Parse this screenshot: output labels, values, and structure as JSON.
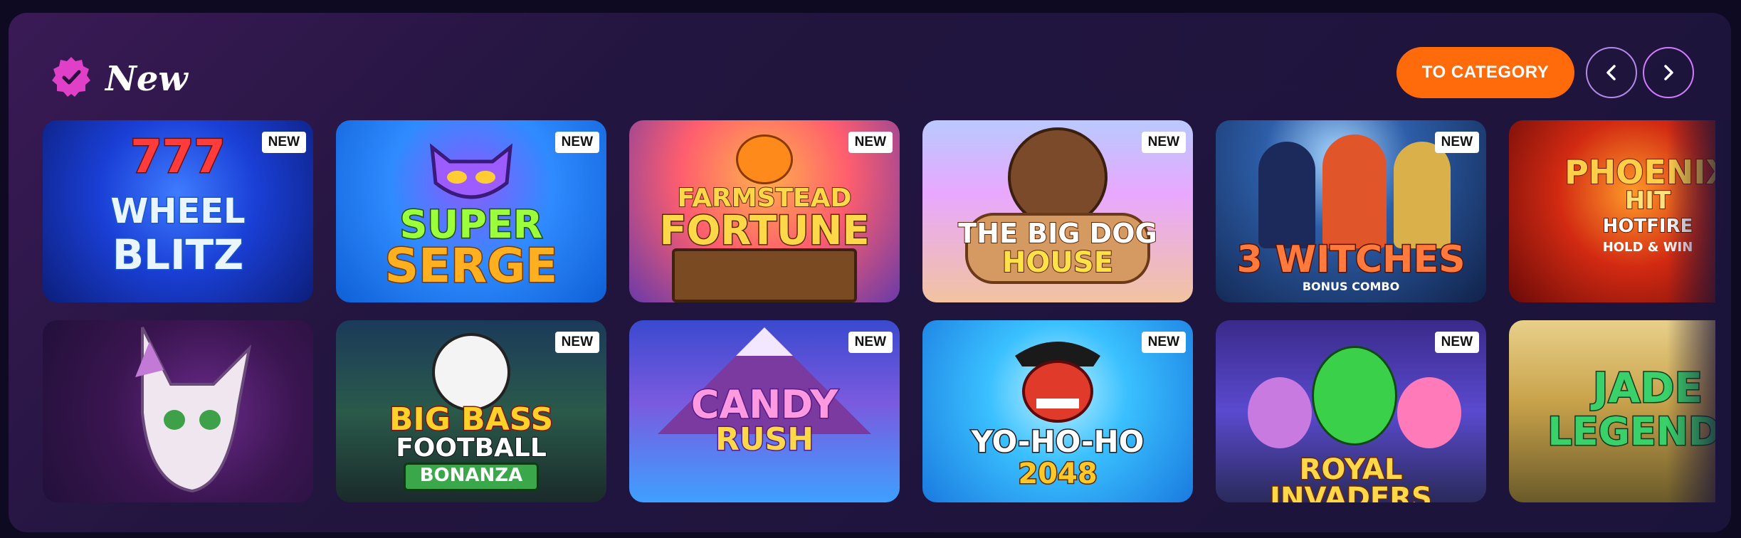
{
  "section": {
    "title": "New",
    "to_category_label": "TO CATEGORY"
  },
  "games": [
    {
      "title_lines": [
        "777",
        "WHEEL",
        "BLITZ"
      ],
      "badge": "NEW"
    },
    {
      "title_lines": [
        "SUPER",
        "SERGE"
      ],
      "badge": "NEW"
    },
    {
      "title_lines": [
        "FARMSTEAD",
        "FORTUNE"
      ],
      "badge": "NEW"
    },
    {
      "title_lines": [
        "THE BIG DOG",
        "HOUSE"
      ],
      "badge": "NEW"
    },
    {
      "title_lines": [
        "3 WITCHES",
        "BONUS COMBO"
      ],
      "badge": "NEW"
    },
    {
      "title_lines": [
        "PHOENIX",
        "HIT",
        "HOTFIRE",
        "HOLD & WIN"
      ],
      "badge": ""
    },
    {
      "title_lines": [],
      "badge": ""
    },
    {
      "title_lines": [
        "BIG BASS",
        "FOOTBALL",
        "BONANZA"
      ],
      "badge": "NEW"
    },
    {
      "title_lines": [
        "CANDY",
        "RUSH"
      ],
      "badge": "NEW"
    },
    {
      "title_lines": [
        "YO-HO-HO",
        "2048"
      ],
      "badge": "NEW"
    },
    {
      "title_lines": [
        "ROYAL INVADERS"
      ],
      "badge": "NEW"
    },
    {
      "title_lines": [
        "JADE",
        "LEGENDS"
      ],
      "badge": ""
    }
  ],
  "colors": {
    "accent_orange": "#ff6a0a",
    "check_badge_pink": "#e040c8",
    "panel_top": "#3a1a55",
    "panel_bottom": "#1b143a"
  },
  "icons": {
    "header": "verified-badge-icon",
    "prev": "chevron-left-icon",
    "next": "chevron-right-icon"
  }
}
